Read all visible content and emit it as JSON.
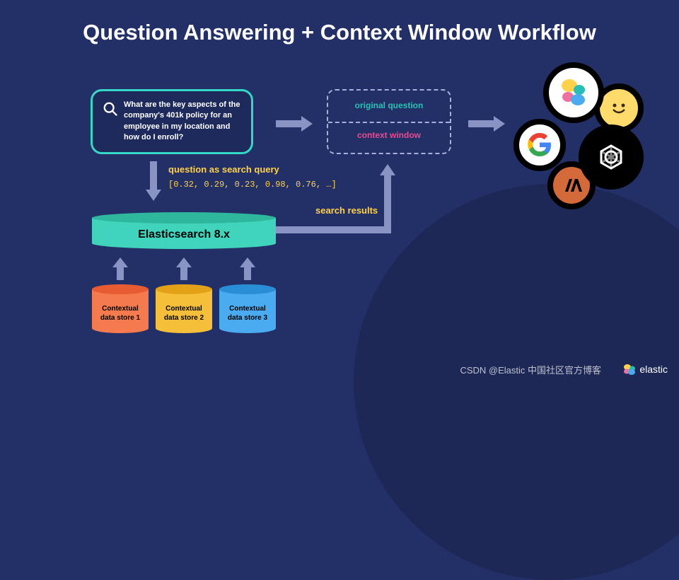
{
  "title": "Question Answering + Context Window Workflow",
  "question": "What are the key aspects of the company's 401k policy for an employee in my location and how do I enroll?",
  "query_label": "question as search query",
  "vector": "[0.32, 0.29, 0.23, 0.98, 0.76, …]",
  "es_label": "Elasticsearch 8.x",
  "datastores": [
    {
      "line1": "Contextual",
      "line2": "data store 1"
    },
    {
      "line1": "Contextual",
      "line2": "data store 2"
    },
    {
      "line1": "Contextual",
      "line2": "data store 3"
    }
  ],
  "context": {
    "top": "original question",
    "bottom": "context window"
  },
  "results_label": "search results",
  "footer": "CSDN @Elastic 中国社区官方博客",
  "brand": "elastic"
}
